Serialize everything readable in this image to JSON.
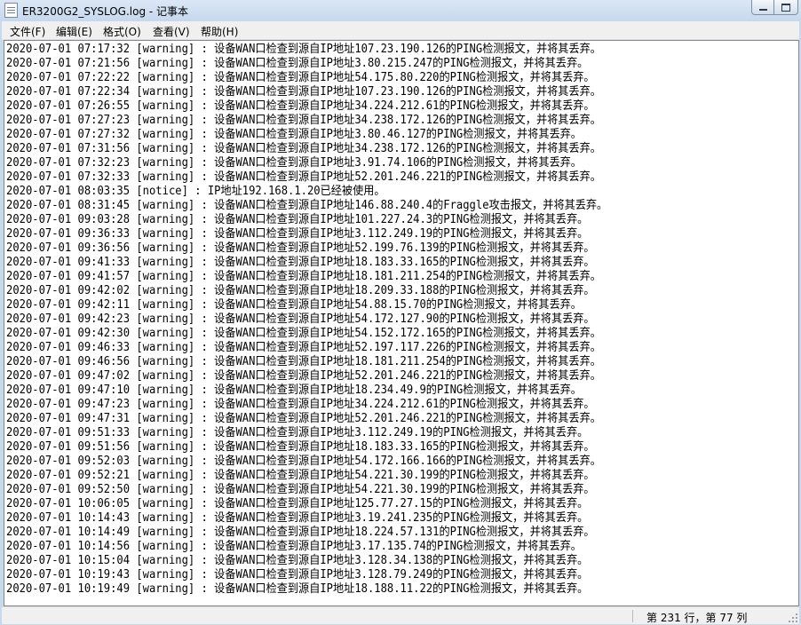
{
  "window": {
    "title": "ER3200G2_SYSLOG.log - 记事本",
    "icon": "notepad-icon",
    "controls": [
      "minimize-icon",
      "maximize-icon"
    ]
  },
  "menu": [
    {
      "label": "文件(F)"
    },
    {
      "label": "编辑(E)"
    },
    {
      "label": "格式(O)"
    },
    {
      "label": "查看(V)"
    },
    {
      "label": "帮助(H)"
    }
  ],
  "editor": {
    "lines": [
      "2020-07-01 07:17:32 [warning] : 设备WAN口检查到源自IP地址107.23.190.126的PING检测报文，并将其丢弃。",
      "2020-07-01 07:21:56 [warning] : 设备WAN口检查到源自IP地址3.80.215.247的PING检测报文，并将其丢弃。",
      "2020-07-01 07:22:22 [warning] : 设备WAN口检查到源自IP地址54.175.80.220的PING检测报文，并将其丢弃。",
      "2020-07-01 07:22:34 [warning] : 设备WAN口检查到源自IP地址107.23.190.126的PING检测报文，并将其丢弃。",
      "2020-07-01 07:26:55 [warning] : 设备WAN口检查到源自IP地址34.224.212.61的PING检测报文，并将其丢弃。",
      "2020-07-01 07:27:23 [warning] : 设备WAN口检查到源自IP地址34.238.172.126的PING检测报文，并将其丢弃。",
      "2020-07-01 07:27:32 [warning] : 设备WAN口检查到源自IP地址3.80.46.127的PING检测报文，并将其丢弃。",
      "2020-07-01 07:31:56 [warning] : 设备WAN口检查到源自IP地址34.238.172.126的PING检测报文，并将其丢弃。",
      "2020-07-01 07:32:23 [warning] : 设备WAN口检查到源自IP地址3.91.74.106的PING检测报文，并将其丢弃。",
      "2020-07-01 07:32:33 [warning] : 设备WAN口检查到源自IP地址52.201.246.221的PING检测报文，并将其丢弃。",
      "2020-07-01 08:03:35 [notice] : IP地址192.168.1.20已经被使用。",
      "2020-07-01 08:31:45 [warning] : 设备WAN口检查到源自IP地址146.88.240.4的Fraggle攻击报文，并将其丢弃。",
      "2020-07-01 09:03:28 [warning] : 设备WAN口检查到源自IP地址101.227.24.3的PING检测报文，并将其丢弃。",
      "2020-07-01 09:36:33 [warning] : 设备WAN口检查到源自IP地址3.112.249.19的PING检测报文，并将其丢弃。",
      "2020-07-01 09:36:56 [warning] : 设备WAN口检查到源自IP地址52.199.76.139的PING检测报文，并将其丢弃。",
      "2020-07-01 09:41:33 [warning] : 设备WAN口检查到源自IP地址18.183.33.165的PING检测报文，并将其丢弃。",
      "2020-07-01 09:41:57 [warning] : 设备WAN口检查到源自IP地址18.181.211.254的PING检测报文，并将其丢弃。",
      "2020-07-01 09:42:02 [warning] : 设备WAN口检查到源自IP地址18.209.33.188的PING检测报文，并将其丢弃。",
      "2020-07-01 09:42:11 [warning] : 设备WAN口检查到源自IP地址54.88.15.70的PING检测报文，并将其丢弃。",
      "2020-07-01 09:42:23 [warning] : 设备WAN口检查到源自IP地址54.172.127.90的PING检测报文，并将其丢弃。",
      "2020-07-01 09:42:30 [warning] : 设备WAN口检查到源自IP地址54.152.172.165的PING检测报文，并将其丢弃。",
      "2020-07-01 09:46:33 [warning] : 设备WAN口检查到源自IP地址52.197.117.226的PING检测报文，并将其丢弃。",
      "2020-07-01 09:46:56 [warning] : 设备WAN口检查到源自IP地址18.181.211.254的PING检测报文，并将其丢弃。",
      "2020-07-01 09:47:02 [warning] : 设备WAN口检查到源自IP地址52.201.246.221的PING检测报文，并将其丢弃。",
      "2020-07-01 09:47:10 [warning] : 设备WAN口检查到源自IP地址18.234.49.9的PING检测报文，并将其丢弃。",
      "2020-07-01 09:47:23 [warning] : 设备WAN口检查到源自IP地址34.224.212.61的PING检测报文，并将其丢弃。",
      "2020-07-01 09:47:31 [warning] : 设备WAN口检查到源自IP地址52.201.246.221的PING检测报文，并将其丢弃。",
      "2020-07-01 09:51:33 [warning] : 设备WAN口检查到源自IP地址3.112.249.19的PING检测报文，并将其丢弃。",
      "2020-07-01 09:51:56 [warning] : 设备WAN口检查到源自IP地址18.183.33.165的PING检测报文，并将其丢弃。",
      "2020-07-01 09:52:03 [warning] : 设备WAN口检查到源自IP地址54.172.166.166的PING检测报文，并将其丢弃。",
      "2020-07-01 09:52:21 [warning] : 设备WAN口检查到源自IP地址54.221.30.199的PING检测报文，并将其丢弃。",
      "2020-07-01 09:52:50 [warning] : 设备WAN口检查到源自IP地址54.221.30.199的PING检测报文，并将其丢弃。",
      "2020-07-01 10:06:05 [warning] : 设备WAN口检查到源自IP地址125.77.27.15的PING检测报文，并将其丢弃。",
      "2020-07-01 10:14:43 [warning] : 设备WAN口检查到源自IP地址3.19.241.235的PING检测报文，并将其丢弃。",
      "2020-07-01 10:14:49 [warning] : 设备WAN口检查到源自IP地址18.224.57.131的PING检测报文，并将其丢弃。",
      "2020-07-01 10:14:56 [warning] : 设备WAN口检查到源自IP地址3.17.135.74的PING检测报文，并将其丢弃。",
      "2020-07-01 10:15:04 [warning] : 设备WAN口检查到源自IP地址3.128.34.138的PING检测报文，并将其丢弃。",
      "2020-07-01 10:19:43 [warning] : 设备WAN口检查到源自IP地址3.128.79.249的PING检测报文，并将其丢弃。",
      "2020-07-01 10:19:49 [warning] : 设备WAN口检查到源自IP地址18.188.11.22的PING检测报文，并将其丢弃。"
    ]
  },
  "status": {
    "position": "第 231 行，第 77 列"
  }
}
